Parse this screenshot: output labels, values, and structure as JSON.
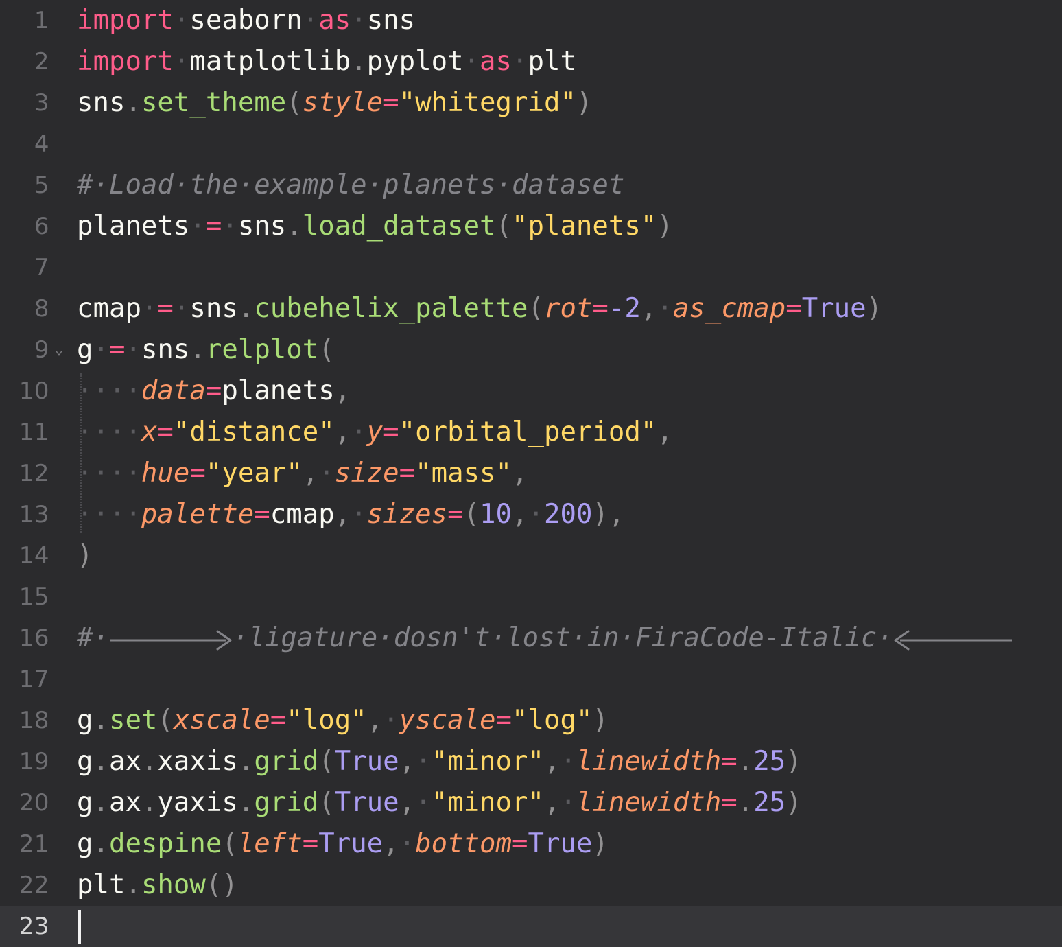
{
  "editor": {
    "language": "python",
    "total_lines": 23,
    "active_line": 23,
    "theme": {
      "background": "#2b2b2d",
      "active_line_background": "#363639",
      "gutter_text": "#6e6e72",
      "gutter_active_text": "#d6d6d6",
      "indent_guide": "#4a4a4e",
      "cursor": "#f2f2f2",
      "keyword": "#ff5c8a",
      "operator": "#ff5c8a",
      "function": "#a9dc76",
      "string": "#ffd866",
      "number": "#ab9df2",
      "constant": "#ab9df2",
      "parameter": "#fc9867",
      "punctuation": "#939293",
      "whitespace_dot": "#5c5c60",
      "comment": "#848489",
      "default_text": "#f8f8f2"
    },
    "whitespace_dot_glyph": "·",
    "fold_chevron_glyph": "⌄",
    "line_numbers": [
      "1",
      "2",
      "3",
      "4",
      "5",
      "6",
      "7",
      "8",
      "9",
      "10",
      "11",
      "12",
      "13",
      "14",
      "15",
      "16",
      "17",
      "18",
      "19",
      "20",
      "21",
      "22",
      "23"
    ],
    "fold_markers": {
      "9": "⌄"
    },
    "plain_source": [
      "import seaborn as sns",
      "import matplotlib.pyplot as plt",
      "sns.set_theme(style=\"whitegrid\")",
      "",
      "# Load the example planets dataset",
      "planets = sns.load_dataset(\"planets\")",
      "",
      "cmap = sns.cubehelix_palette(rot=-2, as_cmap=True)",
      "g = sns.relplot(",
      "    data=planets,",
      "    x=\"distance\", y=\"orbital_period\",",
      "    hue=\"year\", size=\"mass\",",
      "    palette=cmap, sizes=(10, 200),",
      ")",
      "",
      "# ⟶ ligature dosn't lost in FiraCode-Italic ⟵",
      "",
      "g.set(xscale=\"log\", yscale=\"log\")",
      "g.ax.xaxis.grid(True, \"minor\", linewidth=.25)",
      "g.ax.yaxis.grid(True, \"minor\", linewidth=.25)",
      "g.despine(left=True, bottom=True)",
      "plt.show()",
      ""
    ],
    "lines": [
      {
        "n": "1",
        "tokens": [
          {
            "t": "import",
            "c": "kw"
          },
          {
            "t": "·",
            "c": "ws"
          },
          {
            "t": "seaborn",
            "c": "default"
          },
          {
            "t": "·",
            "c": "ws"
          },
          {
            "t": "as",
            "c": "kw"
          },
          {
            "t": "·",
            "c": "ws"
          },
          {
            "t": "sns",
            "c": "default"
          }
        ]
      },
      {
        "n": "2",
        "tokens": [
          {
            "t": "import",
            "c": "kw"
          },
          {
            "t": "·",
            "c": "ws"
          },
          {
            "t": "matplotlib",
            "c": "default"
          },
          {
            "t": ".",
            "c": "punc"
          },
          {
            "t": "pyplot",
            "c": "default"
          },
          {
            "t": "·",
            "c": "ws"
          },
          {
            "t": "as",
            "c": "kw"
          },
          {
            "t": "·",
            "c": "ws"
          },
          {
            "t": "plt",
            "c": "default"
          }
        ]
      },
      {
        "n": "3",
        "tokens": [
          {
            "t": "sns",
            "c": "default"
          },
          {
            "t": ".",
            "c": "punc"
          },
          {
            "t": "set_theme",
            "c": "fn"
          },
          {
            "t": "(",
            "c": "punc"
          },
          {
            "t": "style",
            "c": "param"
          },
          {
            "t": "=",
            "c": "op"
          },
          {
            "t": "\"whitegrid\"",
            "c": "str"
          },
          {
            "t": ")",
            "c": "punc"
          }
        ]
      },
      {
        "n": "4",
        "tokens": []
      },
      {
        "n": "5",
        "tokens": [
          {
            "t": "#·Load·the·example·planets·dataset",
            "c": "comment"
          }
        ]
      },
      {
        "n": "6",
        "tokens": [
          {
            "t": "planets",
            "c": "default"
          },
          {
            "t": "·",
            "c": "ws"
          },
          {
            "t": "=",
            "c": "op"
          },
          {
            "t": "·",
            "c": "ws"
          },
          {
            "t": "sns",
            "c": "default"
          },
          {
            "t": ".",
            "c": "punc"
          },
          {
            "t": "load_dataset",
            "c": "fn"
          },
          {
            "t": "(",
            "c": "punc"
          },
          {
            "t": "\"planets\"",
            "c": "str"
          },
          {
            "t": ")",
            "c": "punc"
          }
        ]
      },
      {
        "n": "7",
        "tokens": []
      },
      {
        "n": "8",
        "tokens": [
          {
            "t": "cmap",
            "c": "default"
          },
          {
            "t": "·",
            "c": "ws"
          },
          {
            "t": "=",
            "c": "op"
          },
          {
            "t": "·",
            "c": "ws"
          },
          {
            "t": "sns",
            "c": "default"
          },
          {
            "t": ".",
            "c": "punc"
          },
          {
            "t": "cubehelix_palette",
            "c": "fn"
          },
          {
            "t": "(",
            "c": "punc"
          },
          {
            "t": "rot",
            "c": "param"
          },
          {
            "t": "=",
            "c": "op"
          },
          {
            "t": "-2",
            "c": "num"
          },
          {
            "t": ",",
            "c": "punc"
          },
          {
            "t": "·",
            "c": "ws"
          },
          {
            "t": "as_cmap",
            "c": "param"
          },
          {
            "t": "=",
            "c": "op"
          },
          {
            "t": "True",
            "c": "const"
          },
          {
            "t": ")",
            "c": "punc"
          }
        ]
      },
      {
        "n": "9",
        "fold": "⌄",
        "tokens": [
          {
            "t": "g",
            "c": "default"
          },
          {
            "t": "·",
            "c": "ws"
          },
          {
            "t": "=",
            "c": "op"
          },
          {
            "t": "·",
            "c": "ws"
          },
          {
            "t": "sns",
            "c": "default"
          },
          {
            "t": ".",
            "c": "punc"
          },
          {
            "t": "relplot",
            "c": "fn"
          },
          {
            "t": "(",
            "c": "punc"
          }
        ]
      },
      {
        "n": "10",
        "indent": true,
        "tokens": [
          {
            "t": "····",
            "c": "ws"
          },
          {
            "t": "data",
            "c": "param"
          },
          {
            "t": "=",
            "c": "op"
          },
          {
            "t": "planets",
            "c": "default"
          },
          {
            "t": ",",
            "c": "punc"
          }
        ]
      },
      {
        "n": "11",
        "indent": true,
        "tokens": [
          {
            "t": "····",
            "c": "ws"
          },
          {
            "t": "x",
            "c": "param"
          },
          {
            "t": "=",
            "c": "op"
          },
          {
            "t": "\"distance\"",
            "c": "str"
          },
          {
            "t": ",",
            "c": "punc"
          },
          {
            "t": "·",
            "c": "ws"
          },
          {
            "t": "y",
            "c": "param"
          },
          {
            "t": "=",
            "c": "op"
          },
          {
            "t": "\"orbital_period\"",
            "c": "str"
          },
          {
            "t": ",",
            "c": "punc"
          }
        ]
      },
      {
        "n": "12",
        "indent": true,
        "tokens": [
          {
            "t": "····",
            "c": "ws"
          },
          {
            "t": "hue",
            "c": "param"
          },
          {
            "t": "=",
            "c": "op"
          },
          {
            "t": "\"year\"",
            "c": "str"
          },
          {
            "t": ",",
            "c": "punc"
          },
          {
            "t": "·",
            "c": "ws"
          },
          {
            "t": "size",
            "c": "param"
          },
          {
            "t": "=",
            "c": "op"
          },
          {
            "t": "\"mass\"",
            "c": "str"
          },
          {
            "t": ",",
            "c": "punc"
          }
        ]
      },
      {
        "n": "13",
        "indent": true,
        "tokens": [
          {
            "t": "····",
            "c": "ws"
          },
          {
            "t": "palette",
            "c": "param"
          },
          {
            "t": "=",
            "c": "op"
          },
          {
            "t": "cmap",
            "c": "default"
          },
          {
            "t": ",",
            "c": "punc"
          },
          {
            "t": "·",
            "c": "ws"
          },
          {
            "t": "sizes",
            "c": "param"
          },
          {
            "t": "=",
            "c": "op"
          },
          {
            "t": "(",
            "c": "punc"
          },
          {
            "t": "10",
            "c": "num"
          },
          {
            "t": ",",
            "c": "punc"
          },
          {
            "t": "·",
            "c": "ws"
          },
          {
            "t": "200",
            "c": "num"
          },
          {
            "t": ")",
            "c": "punc"
          },
          {
            "t": ",",
            "c": "punc"
          }
        ]
      },
      {
        "n": "14",
        "tokens": [
          {
            "t": ")",
            "c": "punc"
          }
        ]
      },
      {
        "n": "15",
        "tokens": []
      },
      {
        "n": "16",
        "comment_with_arrows": true,
        "tokens": [
          {
            "t": "#·",
            "c": "comment"
          },
          {
            "t": "ARROW_RIGHT",
            "c": "arrow-right"
          },
          {
            "t": "·ligature·dosn't·lost·in·FiraCode-Italic·",
            "c": "comment"
          },
          {
            "t": "ARROW_LEFT",
            "c": "arrow-left"
          }
        ]
      },
      {
        "n": "17",
        "tokens": []
      },
      {
        "n": "18",
        "tokens": [
          {
            "t": "g",
            "c": "default"
          },
          {
            "t": ".",
            "c": "punc"
          },
          {
            "t": "set",
            "c": "fn"
          },
          {
            "t": "(",
            "c": "punc"
          },
          {
            "t": "xscale",
            "c": "param"
          },
          {
            "t": "=",
            "c": "op"
          },
          {
            "t": "\"log\"",
            "c": "str"
          },
          {
            "t": ",",
            "c": "punc"
          },
          {
            "t": "·",
            "c": "ws"
          },
          {
            "t": "yscale",
            "c": "param"
          },
          {
            "t": "=",
            "c": "op"
          },
          {
            "t": "\"log\"",
            "c": "str"
          },
          {
            "t": ")",
            "c": "punc"
          }
        ]
      },
      {
        "n": "19",
        "tokens": [
          {
            "t": "g",
            "c": "default"
          },
          {
            "t": ".",
            "c": "punc"
          },
          {
            "t": "ax",
            "c": "default"
          },
          {
            "t": ".",
            "c": "punc"
          },
          {
            "t": "xaxis",
            "c": "default"
          },
          {
            "t": ".",
            "c": "punc"
          },
          {
            "t": "grid",
            "c": "fn"
          },
          {
            "t": "(",
            "c": "punc"
          },
          {
            "t": "True",
            "c": "const"
          },
          {
            "t": ",",
            "c": "punc"
          },
          {
            "t": "·",
            "c": "ws"
          },
          {
            "t": "\"minor\"",
            "c": "str"
          },
          {
            "t": ",",
            "c": "punc"
          },
          {
            "t": "·",
            "c": "ws"
          },
          {
            "t": "linewidth",
            "c": "param"
          },
          {
            "t": "=",
            "c": "op"
          },
          {
            "t": ".",
            "c": "punc"
          },
          {
            "t": "25",
            "c": "num"
          },
          {
            "t": ")",
            "c": "punc"
          }
        ]
      },
      {
        "n": "20",
        "tokens": [
          {
            "t": "g",
            "c": "default"
          },
          {
            "t": ".",
            "c": "punc"
          },
          {
            "t": "ax",
            "c": "default"
          },
          {
            "t": ".",
            "c": "punc"
          },
          {
            "t": "yaxis",
            "c": "default"
          },
          {
            "t": ".",
            "c": "punc"
          },
          {
            "t": "grid",
            "c": "fn"
          },
          {
            "t": "(",
            "c": "punc"
          },
          {
            "t": "True",
            "c": "const"
          },
          {
            "t": ",",
            "c": "punc"
          },
          {
            "t": "·",
            "c": "ws"
          },
          {
            "t": "\"minor\"",
            "c": "str"
          },
          {
            "t": ",",
            "c": "punc"
          },
          {
            "t": "·",
            "c": "ws"
          },
          {
            "t": "linewidth",
            "c": "param"
          },
          {
            "t": "=",
            "c": "op"
          },
          {
            "t": ".",
            "c": "punc"
          },
          {
            "t": "25",
            "c": "num"
          },
          {
            "t": ")",
            "c": "punc"
          }
        ]
      },
      {
        "n": "21",
        "tokens": [
          {
            "t": "g",
            "c": "default"
          },
          {
            "t": ".",
            "c": "punc"
          },
          {
            "t": "despine",
            "c": "fn"
          },
          {
            "t": "(",
            "c": "punc"
          },
          {
            "t": "left",
            "c": "param"
          },
          {
            "t": "=",
            "c": "op"
          },
          {
            "t": "True",
            "c": "const"
          },
          {
            "t": ",",
            "c": "punc"
          },
          {
            "t": "·",
            "c": "ws"
          },
          {
            "t": "bottom",
            "c": "param"
          },
          {
            "t": "=",
            "c": "op"
          },
          {
            "t": "True",
            "c": "const"
          },
          {
            "t": ")",
            "c": "punc"
          }
        ]
      },
      {
        "n": "22",
        "tokens": [
          {
            "t": "plt",
            "c": "default"
          },
          {
            "t": ".",
            "c": "punc"
          },
          {
            "t": "show",
            "c": "fn"
          },
          {
            "t": "(",
            "c": "punc"
          },
          {
            "t": ")",
            "c": "punc"
          }
        ]
      },
      {
        "n": "23",
        "active": true,
        "cursor": true,
        "tokens": []
      }
    ]
  }
}
